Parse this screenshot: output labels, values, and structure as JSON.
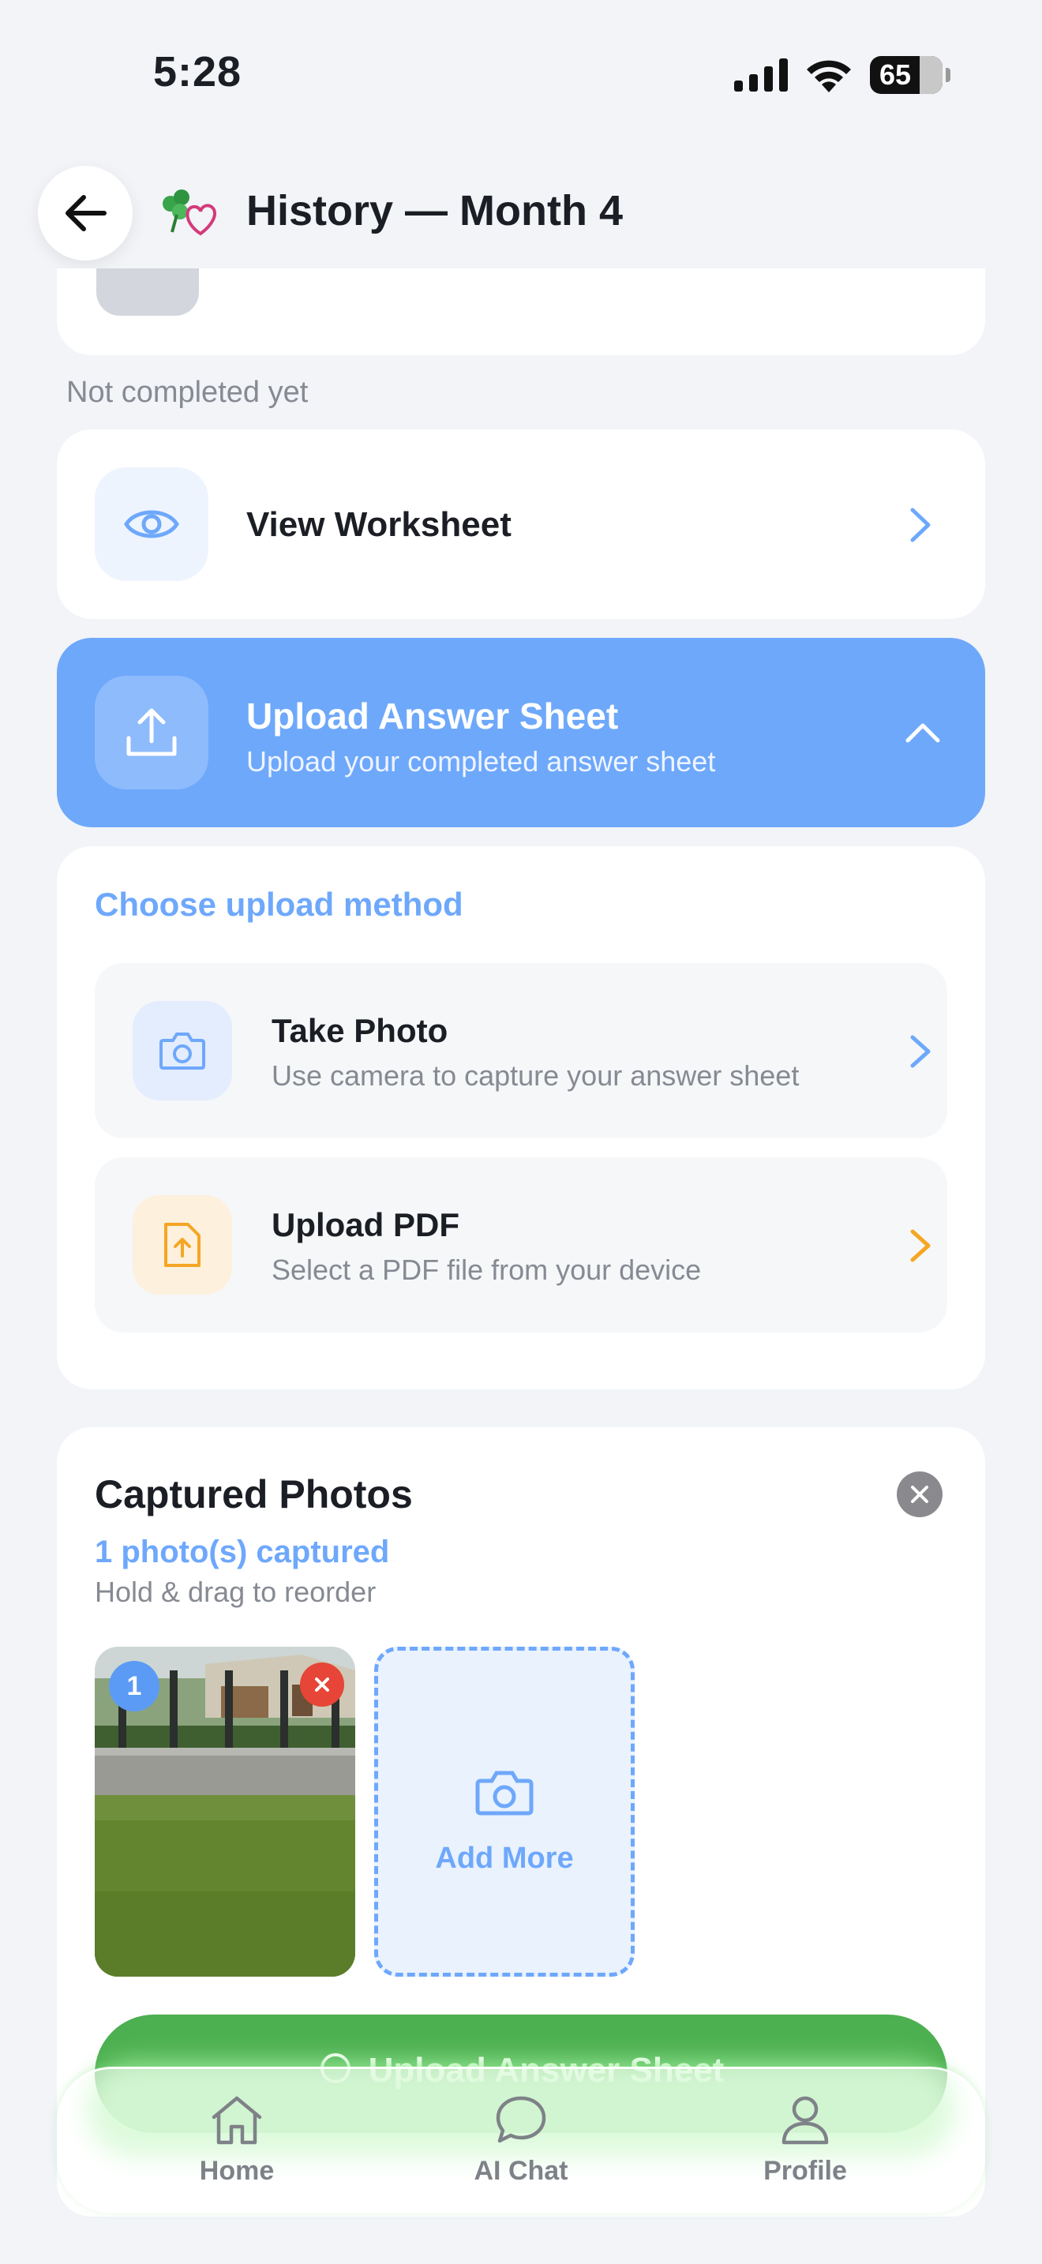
{
  "status_bar": {
    "time": "5:28",
    "battery": "65"
  },
  "header": {
    "title": "History — Month 4",
    "back_icon": "arrow-left-icon",
    "logo_icon": "clover-heart-icon"
  },
  "status_note": "Not completed yet",
  "view_worksheet": {
    "label": "View Worksheet",
    "icon": "eye-icon"
  },
  "upload_answer_sheet": {
    "title": "Upload Answer Sheet",
    "subtitle": "Upload your completed answer sheet",
    "icon": "upload-icon",
    "expanded": true
  },
  "upload_method": {
    "heading": "Choose upload method",
    "options": [
      {
        "title": "Take Photo",
        "subtitle": "Use camera to capture your answer sheet",
        "icon": "camera-icon",
        "accent": "#6ea8fb"
      },
      {
        "title": "Upload PDF",
        "subtitle": "Select a PDF file from your device",
        "icon": "file-upload-icon",
        "accent": "#f5a623"
      }
    ]
  },
  "captured_photos": {
    "title": "Captured Photos",
    "count_text": "1 photo(s) captured",
    "hint": "Hold & drag to reorder",
    "photos": [
      {
        "index": "1"
      }
    ],
    "add_more_label": "Add More",
    "submit_label": "Upload Answer Sheet"
  },
  "bottom_nav": {
    "items": [
      {
        "label": "Home",
        "icon": "home-icon"
      },
      {
        "label": "AI Chat",
        "icon": "chat-bubble-icon"
      },
      {
        "label": "Profile",
        "icon": "person-icon"
      }
    ]
  },
  "colors": {
    "accent_blue": "#6ea8fb",
    "success_green": "#4caf50",
    "pdf_orange": "#f5a623",
    "delete_red": "#e64537"
  }
}
